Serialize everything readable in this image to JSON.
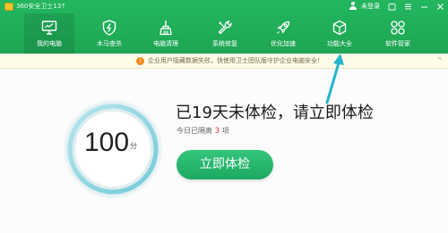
{
  "app": {
    "title": "360安全卫士13",
    "update_mark": "↑"
  },
  "titlebar": {
    "login_label": "未登录",
    "icons": [
      "user-icon",
      "skin-icon",
      "menu-icon",
      "minimize-icon",
      "close-icon"
    ]
  },
  "nav": {
    "items": [
      {
        "label": "我的电脑",
        "icon": "computer-icon",
        "active": true
      },
      {
        "label": "木马查杀",
        "icon": "shield-icon",
        "active": false
      },
      {
        "label": "电脑清理",
        "icon": "broom-icon",
        "active": false
      },
      {
        "label": "系统修复",
        "icon": "wrench-icon",
        "active": false
      },
      {
        "label": "优化加速",
        "icon": "rocket-icon",
        "active": false
      },
      {
        "label": "功能大全",
        "icon": "box-icon",
        "active": false
      },
      {
        "label": "软件管家",
        "icon": "apps-icon",
        "active": false
      }
    ]
  },
  "notice": {
    "text": "企业用户隐藏数据失败，快使用卫士团队版守护企业电脑安全！",
    "close_symbol": "^"
  },
  "score": {
    "value": "100",
    "unit": "分"
  },
  "headline": "已19天未体检，请立即体检",
  "subline": {
    "prefix": "今日已隔离",
    "count": "3",
    "suffix": "项"
  },
  "primary_button": {
    "label": "立即体检"
  },
  "colors": {
    "header": "#1ea653",
    "button": "#26b46c",
    "annotation_arrow": "#22b5c9",
    "ring": "#63c8d6"
  }
}
